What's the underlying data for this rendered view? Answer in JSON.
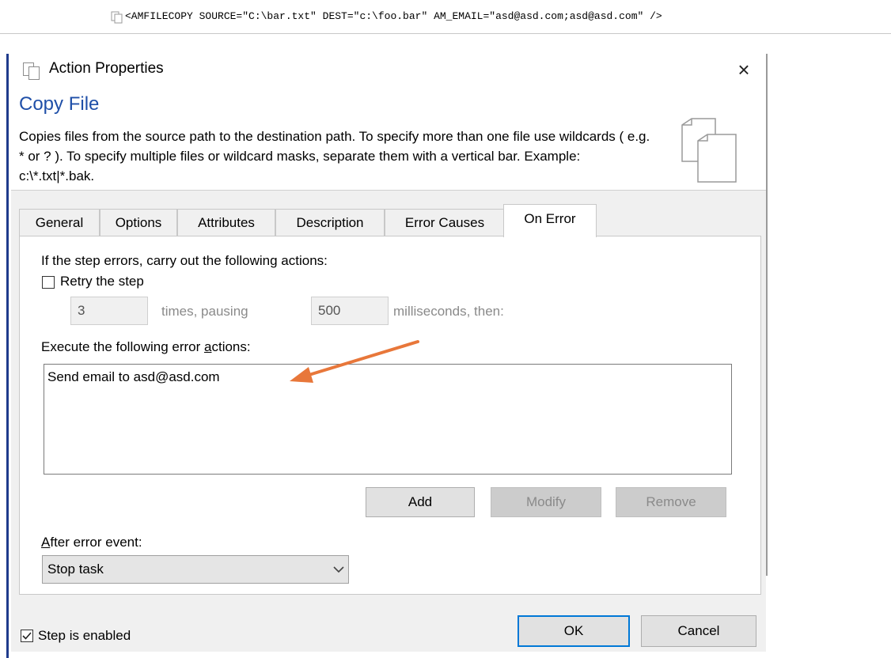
{
  "code_line": {
    "text": "<AMFILECOPY SOURCE=\"C:\\bar.txt\" DEST=\"c:\\foo.bar\" AM_EMAIL=\"asd@asd.com;asd@asd.com\" />"
  },
  "window": {
    "title": "Action Properties",
    "close_label": "×"
  },
  "header": {
    "heading": "Copy File",
    "description": "Copies files from the source path to the destination path.  To specify more than one file use wildcards ( e.g. * or ? ).  To specify multiple files or wildcard masks, separate them with a vertical bar.  Example: c:\\*.txt|*.bak."
  },
  "tabs": [
    {
      "label": "General"
    },
    {
      "label": "Options"
    },
    {
      "label": "Attributes"
    },
    {
      "label": "Description"
    },
    {
      "label": "Error Causes"
    },
    {
      "label": "On Error",
      "active": true
    }
  ],
  "on_error": {
    "intro": "If the step errors, carry out the following actions:",
    "retry_label": "Retry the step",
    "retry_checked": false,
    "times_value": "3",
    "times_label": "times, pausing",
    "ms_value": "500",
    "ms_label": "milliseconds, then:",
    "actions_label_pre": "Execute the following error ",
    "actions_label_accel": "a",
    "actions_label_post": "ctions:",
    "actions": [
      "Send email to asd@asd.com"
    ],
    "add_label": "Add",
    "modify_label": "Modify",
    "remove_label": "Remove",
    "after_label_accel": "A",
    "after_label_rest": "fter error event:",
    "after_value": "Stop task"
  },
  "footer": {
    "enabled_label": "Step is enabled",
    "enabled_checked": true,
    "ok_label": "OK",
    "cancel_label": "Cancel"
  },
  "colors": {
    "heading": "#1f4fa8",
    "arrow": "#e8773a",
    "ok_border": "#0078d7"
  }
}
